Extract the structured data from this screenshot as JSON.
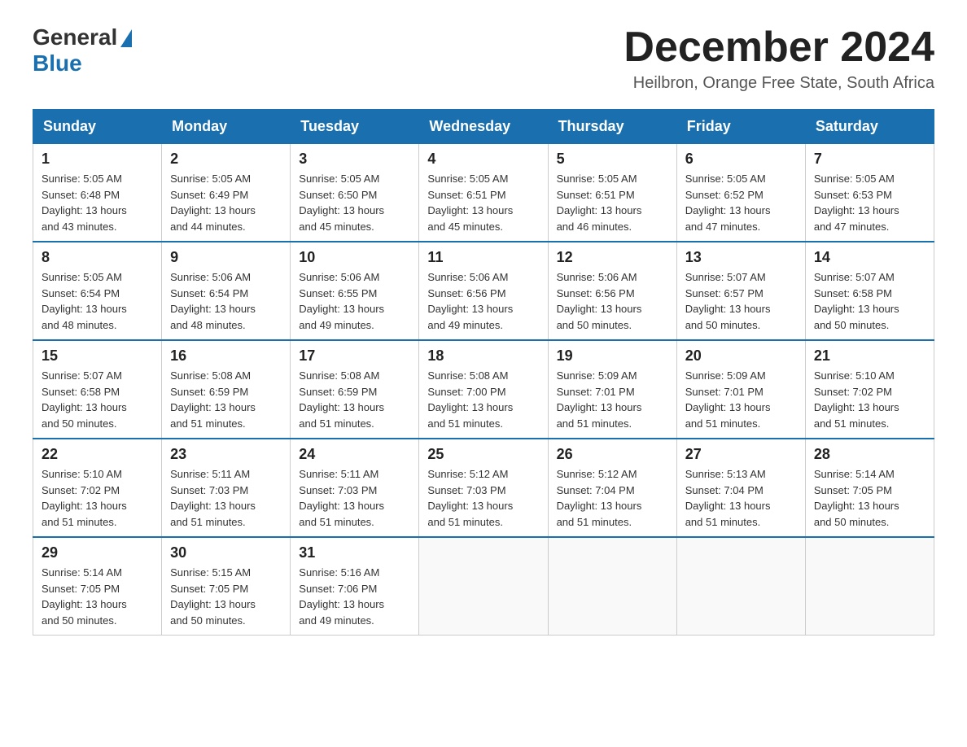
{
  "logo": {
    "general": "General",
    "blue": "Blue"
  },
  "title": "December 2024",
  "location": "Heilbron, Orange Free State, South Africa",
  "weekdays": [
    "Sunday",
    "Monday",
    "Tuesday",
    "Wednesday",
    "Thursday",
    "Friday",
    "Saturday"
  ],
  "weeks": [
    [
      {
        "day": "1",
        "sunrise": "5:05 AM",
        "sunset": "6:48 PM",
        "daylight": "13 hours and 43 minutes."
      },
      {
        "day": "2",
        "sunrise": "5:05 AM",
        "sunset": "6:49 PM",
        "daylight": "13 hours and 44 minutes."
      },
      {
        "day": "3",
        "sunrise": "5:05 AM",
        "sunset": "6:50 PM",
        "daylight": "13 hours and 45 minutes."
      },
      {
        "day": "4",
        "sunrise": "5:05 AM",
        "sunset": "6:51 PM",
        "daylight": "13 hours and 45 minutes."
      },
      {
        "day": "5",
        "sunrise": "5:05 AM",
        "sunset": "6:51 PM",
        "daylight": "13 hours and 46 minutes."
      },
      {
        "day": "6",
        "sunrise": "5:05 AM",
        "sunset": "6:52 PM",
        "daylight": "13 hours and 47 minutes."
      },
      {
        "day": "7",
        "sunrise": "5:05 AM",
        "sunset": "6:53 PM",
        "daylight": "13 hours and 47 minutes."
      }
    ],
    [
      {
        "day": "8",
        "sunrise": "5:05 AM",
        "sunset": "6:54 PM",
        "daylight": "13 hours and 48 minutes."
      },
      {
        "day": "9",
        "sunrise": "5:06 AM",
        "sunset": "6:54 PM",
        "daylight": "13 hours and 48 minutes."
      },
      {
        "day": "10",
        "sunrise": "5:06 AM",
        "sunset": "6:55 PM",
        "daylight": "13 hours and 49 minutes."
      },
      {
        "day": "11",
        "sunrise": "5:06 AM",
        "sunset": "6:56 PM",
        "daylight": "13 hours and 49 minutes."
      },
      {
        "day": "12",
        "sunrise": "5:06 AM",
        "sunset": "6:56 PM",
        "daylight": "13 hours and 50 minutes."
      },
      {
        "day": "13",
        "sunrise": "5:07 AM",
        "sunset": "6:57 PM",
        "daylight": "13 hours and 50 minutes."
      },
      {
        "day": "14",
        "sunrise": "5:07 AM",
        "sunset": "6:58 PM",
        "daylight": "13 hours and 50 minutes."
      }
    ],
    [
      {
        "day": "15",
        "sunrise": "5:07 AM",
        "sunset": "6:58 PM",
        "daylight": "13 hours and 50 minutes."
      },
      {
        "day": "16",
        "sunrise": "5:08 AM",
        "sunset": "6:59 PM",
        "daylight": "13 hours and 51 minutes."
      },
      {
        "day": "17",
        "sunrise": "5:08 AM",
        "sunset": "6:59 PM",
        "daylight": "13 hours and 51 minutes."
      },
      {
        "day": "18",
        "sunrise": "5:08 AM",
        "sunset": "7:00 PM",
        "daylight": "13 hours and 51 minutes."
      },
      {
        "day": "19",
        "sunrise": "5:09 AM",
        "sunset": "7:01 PM",
        "daylight": "13 hours and 51 minutes."
      },
      {
        "day": "20",
        "sunrise": "5:09 AM",
        "sunset": "7:01 PM",
        "daylight": "13 hours and 51 minutes."
      },
      {
        "day": "21",
        "sunrise": "5:10 AM",
        "sunset": "7:02 PM",
        "daylight": "13 hours and 51 minutes."
      }
    ],
    [
      {
        "day": "22",
        "sunrise": "5:10 AM",
        "sunset": "7:02 PM",
        "daylight": "13 hours and 51 minutes."
      },
      {
        "day": "23",
        "sunrise": "5:11 AM",
        "sunset": "7:03 PM",
        "daylight": "13 hours and 51 minutes."
      },
      {
        "day": "24",
        "sunrise": "5:11 AM",
        "sunset": "7:03 PM",
        "daylight": "13 hours and 51 minutes."
      },
      {
        "day": "25",
        "sunrise": "5:12 AM",
        "sunset": "7:03 PM",
        "daylight": "13 hours and 51 minutes."
      },
      {
        "day": "26",
        "sunrise": "5:12 AM",
        "sunset": "7:04 PM",
        "daylight": "13 hours and 51 minutes."
      },
      {
        "day": "27",
        "sunrise": "5:13 AM",
        "sunset": "7:04 PM",
        "daylight": "13 hours and 51 minutes."
      },
      {
        "day": "28",
        "sunrise": "5:14 AM",
        "sunset": "7:05 PM",
        "daylight": "13 hours and 50 minutes."
      }
    ],
    [
      {
        "day": "29",
        "sunrise": "5:14 AM",
        "sunset": "7:05 PM",
        "daylight": "13 hours and 50 minutes."
      },
      {
        "day": "30",
        "sunrise": "5:15 AM",
        "sunset": "7:05 PM",
        "daylight": "13 hours and 50 minutes."
      },
      {
        "day": "31",
        "sunrise": "5:16 AM",
        "sunset": "7:06 PM",
        "daylight": "13 hours and 49 minutes."
      },
      null,
      null,
      null,
      null
    ]
  ],
  "labels": {
    "sunrise": "Sunrise:",
    "sunset": "Sunset:",
    "daylight": "Daylight:"
  }
}
